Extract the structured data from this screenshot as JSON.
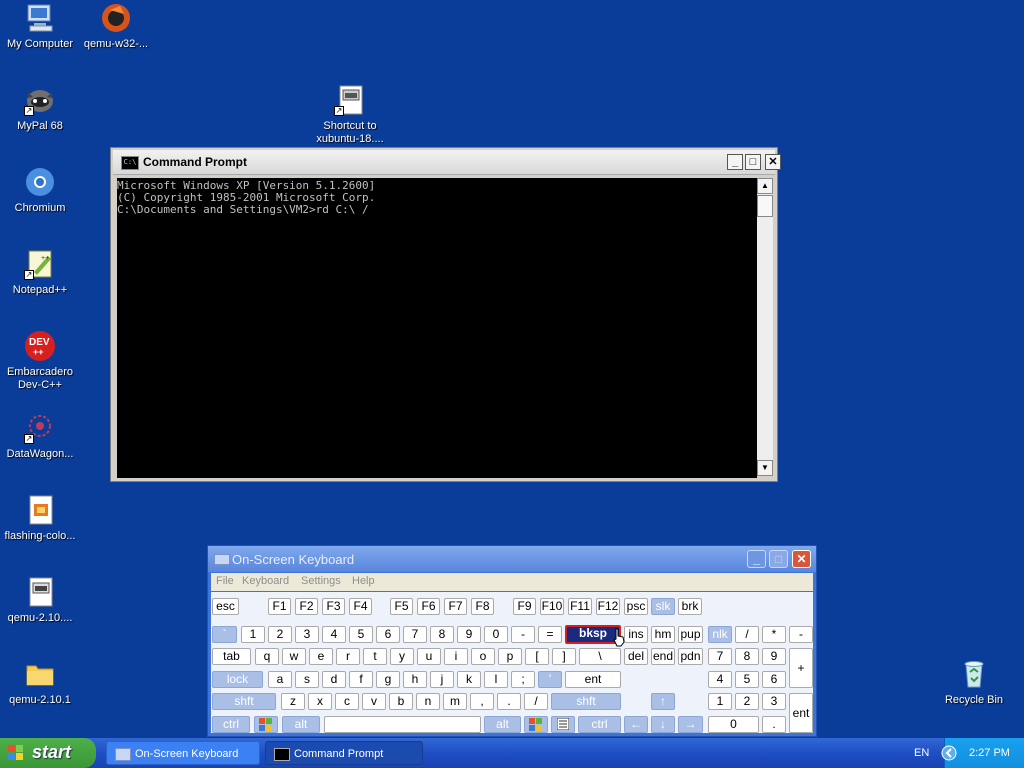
{
  "desktop": {
    "icons": [
      {
        "label": "My Computer",
        "kind": "computer-icon"
      },
      {
        "label": "qemu-w32-...",
        "kind": "qemu-icon"
      },
      {
        "label": "MyPal 68",
        "kind": "mypal-icon"
      },
      {
        "label": "Shortcut to",
        "label2": "xubuntu-18....",
        "kind": "shortcut-file-icon"
      },
      {
        "label": "Chromium",
        "kind": "chromium-icon"
      },
      {
        "label": "Notepad++",
        "kind": "notepadpp-icon"
      },
      {
        "label": "Embarcadero",
        "label2": "Dev-C++",
        "kind": "devcpp-icon"
      },
      {
        "label": "DataWagon...",
        "kind": "datawagon-icon"
      },
      {
        "label": "flashing-colo...",
        "kind": "html-file-icon"
      },
      {
        "label": "qemu-2.10....",
        "kind": "exe-file-icon"
      },
      {
        "label": "qemu-2.10.1",
        "kind": "folder-icon"
      },
      {
        "label": "Recycle Bin",
        "kind": "recycle-bin-icon"
      }
    ]
  },
  "cmd": {
    "title": "Command Prompt",
    "lines": [
      "Microsoft Windows XP [Version 5.1.2600]",
      "(C) Copyright 1985-2001 Microsoft Corp.",
      "",
      "C:\\Documents and Settings\\VM2>rd C:\\ /"
    ]
  },
  "osk": {
    "title": "On-Screen Keyboard",
    "menu": [
      "File",
      "Keyboard",
      "Settings",
      "Help"
    ],
    "keys": {
      "esc": "esc",
      "f1": "F1",
      "f2": "F2",
      "f3": "F3",
      "f4": "F4",
      "f5": "F5",
      "f6": "F6",
      "f7": "F7",
      "f8": "F8",
      "f9": "F9",
      "f10": "F10",
      "f11": "F11",
      "f12": "F12",
      "psc": "psc",
      "slk": "slk",
      "brk": "brk",
      "grave": "`",
      "n1": "1",
      "n2": "2",
      "n3": "3",
      "n4": "4",
      "n5": "5",
      "n6": "6",
      "n7": "7",
      "n8": "8",
      "n9": "9",
      "n0": "0",
      "minus": "-",
      "equals": "=",
      "bksp": "bksp",
      "ins": "ins",
      "hm": "hm",
      "pup": "pup",
      "nlk": "nlk",
      "slash": "/",
      "star": "*",
      "npminus": "-",
      "tab": "tab",
      "q": "q",
      "w": "w",
      "e": "e",
      "r": "r",
      "t": "t",
      "y": "y",
      "u": "u",
      "i": "i",
      "o": "o",
      "p": "p",
      "lbr": "[",
      "rbr": "]",
      "bslash": "\\",
      "del": "del",
      "end": "end",
      "pdn": "pdn",
      "np7": "7",
      "np8": "8",
      "np9": "9",
      "npplus": "+",
      "lock": "lock",
      "a": "a",
      "s": "s",
      "d": "d",
      "f": "f",
      "g": "g",
      "h": "h",
      "j": "j",
      "k": "k",
      "l": "l",
      "semi": ";",
      "quote": "'",
      "ent": "ent",
      "np4": "4",
      "np5": "5",
      "np6": "6",
      "lshft": "shft",
      "z": "z",
      "x": "x",
      "c": "c",
      "v": "v",
      "b": "b",
      "n": "n",
      "m": "m",
      "comma": ",",
      "period": ".",
      "fslash": "/",
      "rshft": "shft",
      "up": "↑",
      "np1": "1",
      "np2": "2",
      "np3": "3",
      "npent": "ent",
      "lctrl": "ctrl",
      "lalt": "alt",
      "ralt": "alt",
      "rctrl": "ctrl",
      "left": "←",
      "down": "↓",
      "right": "→",
      "np0": "0",
      "npdot": "."
    }
  },
  "taskbar": {
    "start_label": "start",
    "tasks": [
      {
        "label": "On-Screen Keyboard"
      },
      {
        "label": "Command Prompt"
      }
    ],
    "lang": "EN",
    "clock": "2:27 PM"
  },
  "colors": {
    "desktop": "#0a3d9a",
    "xp_blue": "#3d74d8",
    "start_green": "#3a9636"
  }
}
